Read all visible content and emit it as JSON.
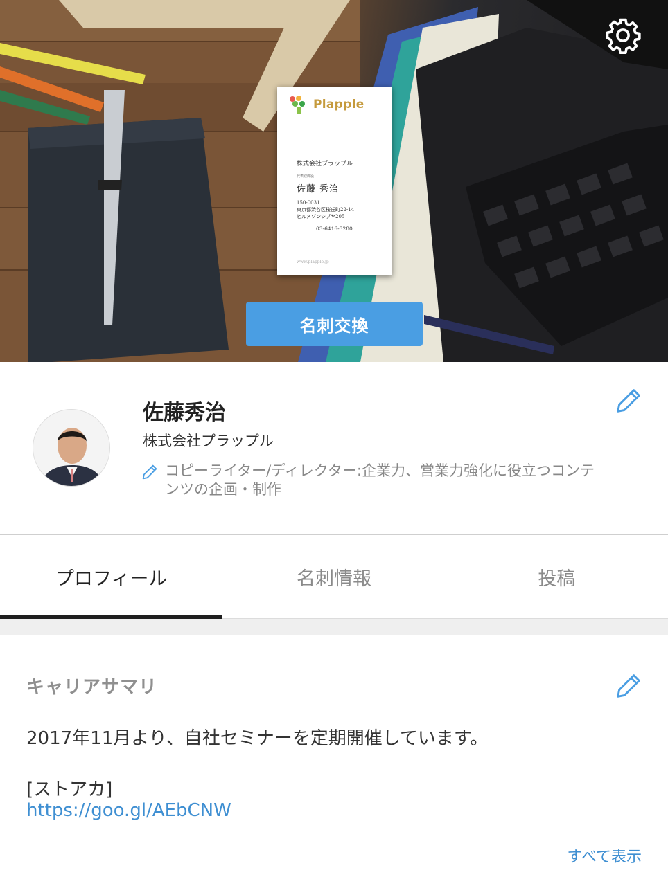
{
  "hero": {
    "card": {
      "logo_text": "Plapple",
      "company": "株式会社プラップル",
      "role": "代表取締役",
      "person": "佐藤 秀治",
      "address_lines": [
        "150-0031",
        "東京都渋谷区桜丘町22-14",
        "ヒルメゾンシブヤ205"
      ],
      "tel": "03-6416-3280",
      "url": "www.plapple.jp"
    },
    "exchange_button_label": "名刺交換"
  },
  "profile": {
    "name": "佐藤秀治",
    "company": "株式会社プラップル",
    "tagline": "コピーライター/ディレクター:企業力、営業力強化に役立つコンテンツの企画・制作"
  },
  "tabs": [
    {
      "label": "プロフィール",
      "active": true
    },
    {
      "label": "名刺情報",
      "active": false
    },
    {
      "label": "投稿",
      "active": false
    }
  ],
  "career_summary": {
    "title": "キャリアサマリ",
    "line1": "2017年11月より、自社セミナーを定期開催しています。",
    "line2": "[ストアカ]",
    "link": "https://goo.gl/AEbCNW",
    "show_all": "すべて表示"
  },
  "colors": {
    "accent_blue": "#4a9ee3",
    "link_blue": "#3f8fd2",
    "tab_indicator": "#1f1f1f"
  },
  "icons": [
    "gear-icon",
    "pencil-icon"
  ]
}
